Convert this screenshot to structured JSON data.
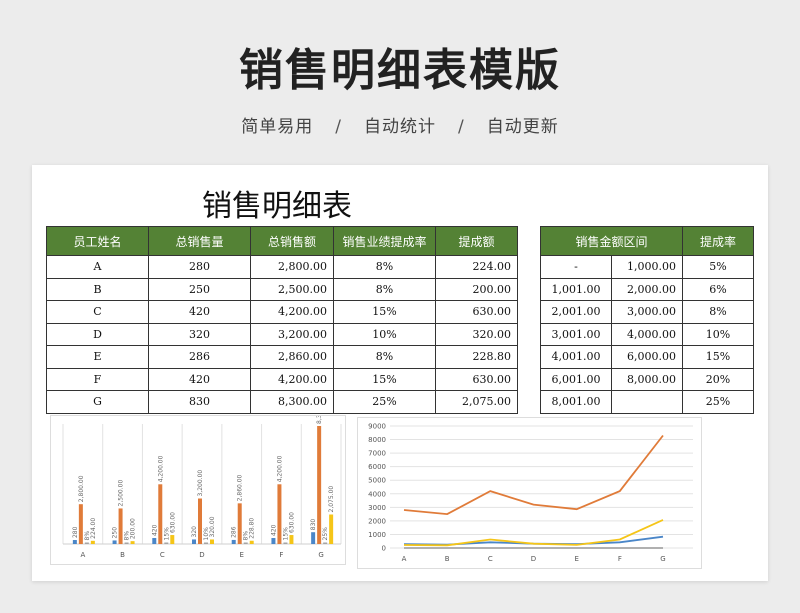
{
  "header": {
    "title": "销售明细表模版",
    "subtitle_items": [
      "简单易用",
      "自动统计",
      "自动更新"
    ],
    "separator": "/"
  },
  "sheet": {
    "title": "销售明细表",
    "main_table": {
      "headers": [
        "员工姓名",
        "总销售量",
        "总销售额",
        "销售业绩提成率",
        "提成额"
      ],
      "rows": [
        [
          "A",
          "280",
          "2,800.00",
          "8%",
          "224.00"
        ],
        [
          "B",
          "250",
          "2,500.00",
          "8%",
          "200.00"
        ],
        [
          "C",
          "420",
          "4,200.00",
          "15%",
          "630.00"
        ],
        [
          "D",
          "320",
          "3,200.00",
          "10%",
          "320.00"
        ],
        [
          "E",
          "286",
          "2,860.00",
          "8%",
          "228.80"
        ],
        [
          "F",
          "420",
          "4,200.00",
          "15%",
          "630.00"
        ],
        [
          "G",
          "830",
          "8,300.00",
          "25%",
          "2,075.00"
        ]
      ]
    },
    "rate_table": {
      "headers": [
        "销售金额区间",
        "提成率"
      ],
      "rows": [
        [
          "-",
          "1,000.00",
          "5%"
        ],
        [
          "1,001.00",
          "2,000.00",
          "6%"
        ],
        [
          "2,001.00",
          "3,000.00",
          "8%"
        ],
        [
          "3,001.00",
          "4,000.00",
          "10%"
        ],
        [
          "4,001.00",
          "6,000.00",
          "15%"
        ],
        [
          "6,001.00",
          "8,000.00",
          "20%"
        ],
        [
          "8,001.00",
          "",
          "25%"
        ]
      ]
    }
  },
  "chart_data": [
    {
      "type": "bar",
      "categories": [
        "A",
        "B",
        "C",
        "D",
        "E",
        "F",
        "G"
      ],
      "series": [
        {
          "values": [
            280,
            250,
            420,
            320,
            286,
            420,
            830
          ],
          "labels": [
            "280",
            "250",
            "420",
            "320",
            "286",
            "420",
            "830"
          ],
          "color": "#4a86c8"
        },
        {
          "values": [
            2800,
            2500,
            4200,
            3200,
            2860,
            4200,
            8300
          ],
          "labels": [
            "2,800.00",
            "2,500.00",
            "4,200.00",
            "3,200.00",
            "2,860.00",
            "4,200.00",
            "8,300.00"
          ],
          "color": "#e07b39"
        },
        {
          "values": [
            0.08,
            0.08,
            0.15,
            0.1,
            0.08,
            0.15,
            0.25
          ],
          "labels": [
            "8%",
            "8%",
            "15%",
            "10%",
            "8%",
            "15%",
            "25%"
          ],
          "color": "#a5a5a5"
        },
        {
          "values": [
            224,
            200,
            630,
            320,
            228.8,
            630,
            2075
          ],
          "labels": [
            "224.00",
            "200.00",
            "630.00",
            "320.00",
            "228.80",
            "630.00",
            "2,075.00"
          ],
          "color": "#f5c518"
        }
      ],
      "ylim": [
        0,
        8300
      ],
      "grid": true
    },
    {
      "type": "line",
      "categories": [
        "A",
        "B",
        "C",
        "D",
        "E",
        "F",
        "G"
      ],
      "series": [
        {
          "values": [
            280,
            250,
            420,
            320,
            286,
            420,
            830
          ],
          "color": "#4a86c8"
        },
        {
          "values": [
            2800,
            2500,
            4200,
            3200,
            2860,
            4200,
            8300
          ],
          "color": "#e07b39"
        },
        {
          "values": [
            0.08,
            0.08,
            0.15,
            0.1,
            0.08,
            0.15,
            0.25
          ],
          "color": "#a5a5a5"
        },
        {
          "values": [
            224,
            200,
            630,
            320,
            228.8,
            630,
            2075
          ],
          "color": "#f5c518"
        }
      ],
      "yticks": [
        0,
        1000,
        2000,
        3000,
        4000,
        5000,
        6000,
        7000,
        8000,
        9000
      ],
      "ylim": [
        0,
        9000
      ],
      "grid": true
    }
  ]
}
